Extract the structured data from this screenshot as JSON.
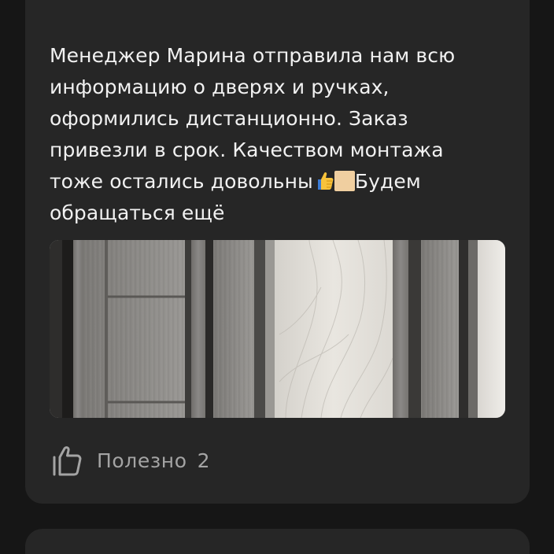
{
  "review": {
    "text_part1": "Менеджер Марина отправила нам всю\nинформацию о дверях и ручках,\nоформились дистанционно. Заказ\nпривезли в срок. Качеством монтажа\nтоже остались довольны",
    "text_part2": "Будем\nобращаться ещё",
    "emoji_1": "thumbs-up-icon",
    "emoji_2": "skin-tone-modifier-icon"
  },
  "photo": {
    "subject": "door-photo"
  },
  "helpful": {
    "icon": "thumbs-up-icon",
    "label": "Полезно",
    "count": "2"
  },
  "colors": {
    "background": "#161616",
    "card": "#262626",
    "text": "#f1f1f1",
    "muted": "#a4a4a4"
  }
}
